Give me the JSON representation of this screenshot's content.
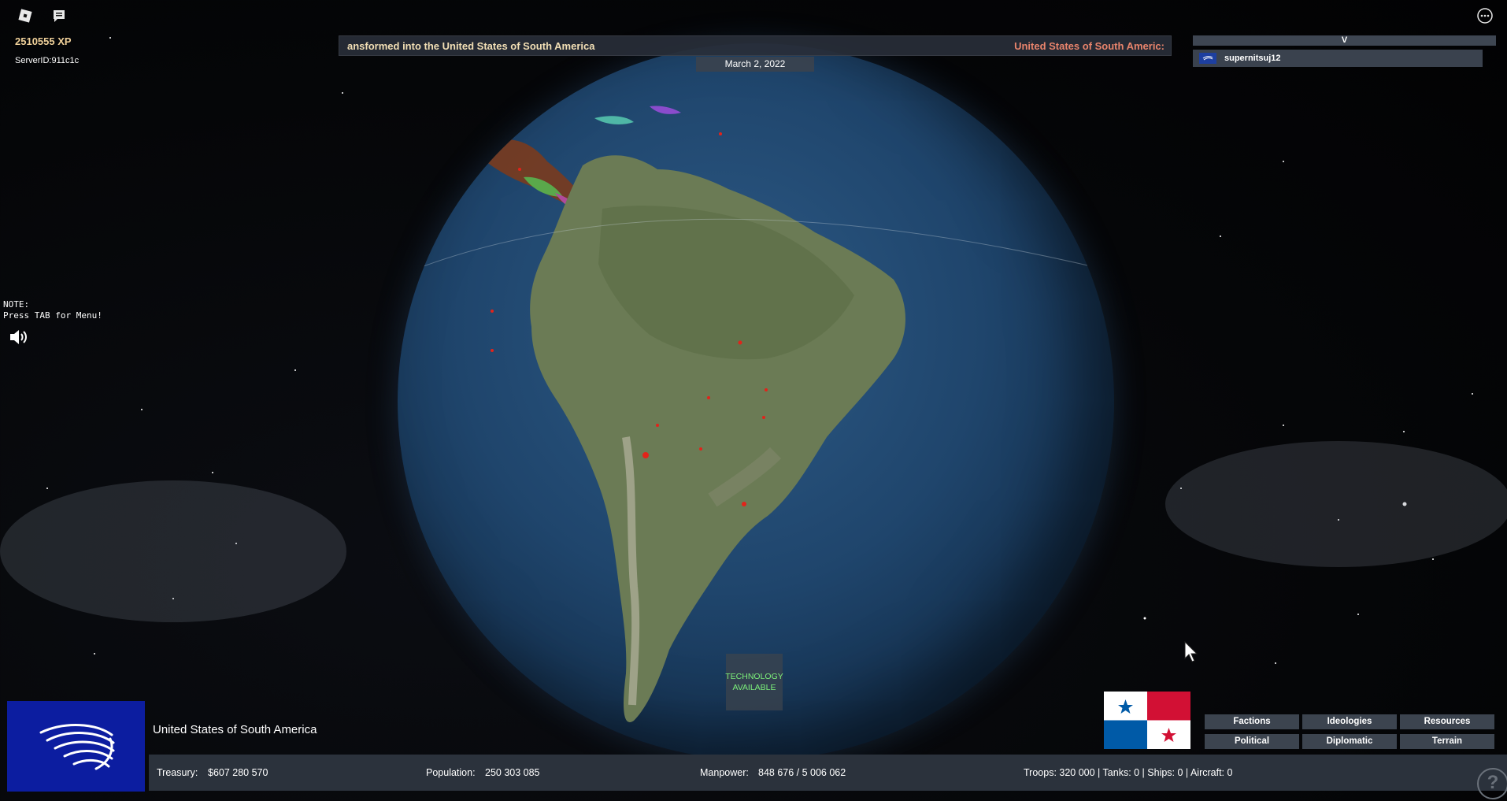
{
  "hud": {
    "xp": "2510555 XP",
    "server_id": "ServerID:911c1c",
    "note_title": "NOTE:",
    "note_text": "Press TAB for Menu!"
  },
  "ticker": {
    "left_text": "ansformed into the United States of South America",
    "right_text": "United States of South Americ:"
  },
  "date": "March 2, 2022",
  "players": {
    "header": "V",
    "list": [
      {
        "name": "supernitsuj12"
      }
    ]
  },
  "tech_notice": {
    "line1": "TECHNOLOGY",
    "line2": "AVAILABLE"
  },
  "country": {
    "name": "United States of South America"
  },
  "stats": {
    "treasury_label": "Treasury:",
    "treasury_value": "$607 280 570",
    "population_label": "Population:",
    "population_value": "250 303 085",
    "manpower_label": "Manpower:",
    "manpower_value": "848 676  /  5 006 062",
    "military": "Troops: 320 000  |  Tanks: 0  |  Ships: 0  |  Aircraft: 0"
  },
  "map_modes": {
    "factions": "Factions",
    "ideologies": "Ideologies",
    "resources": "Resources",
    "political": "Political",
    "diplomatic": "Diplomatic",
    "terrain": "Terrain"
  },
  "help_glyph": "?",
  "colors": {
    "xp": "#f0d19a",
    "ticker_left": "#f2dfb5",
    "ticker_right": "#e8846c",
    "tech_text": "#7cf07a",
    "panel_bg": "#2b323c",
    "emblem_bg": "#0c1da0"
  }
}
